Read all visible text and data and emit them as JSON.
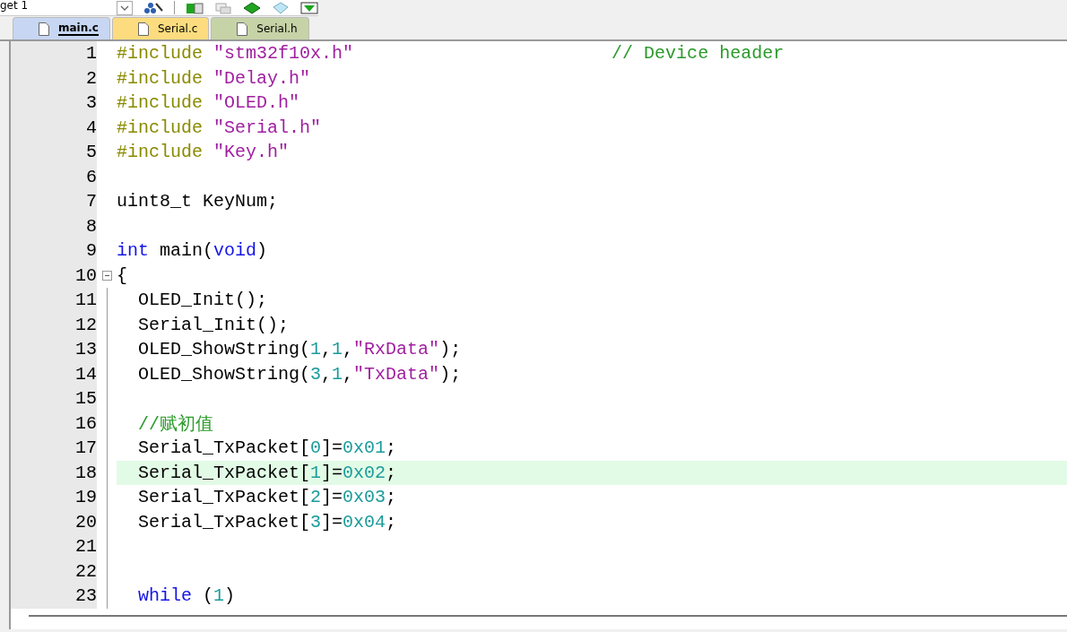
{
  "toolbar": {
    "target_select": "get 1"
  },
  "tabs": [
    {
      "label": "main.c",
      "selected": true,
      "color": "#c7d6f2"
    },
    {
      "label": "Serial.c",
      "selected": false,
      "color": "#fcdc7e"
    },
    {
      "label": "Serial.h",
      "selected": false,
      "color": "#c6d3a6"
    }
  ],
  "editor": {
    "lines": [
      {
        "number": "1",
        "kind": "line",
        "highlighted": false,
        "tokens": [
          {
            "kind": "preproc",
            "text": "#include "
          },
          {
            "kind": "string",
            "text": "\"stm32f10x.h\""
          },
          {
            "kind": "comment",
            "text": "                        // Device header"
          }
        ]
      },
      {
        "number": "2",
        "kind": "line",
        "highlighted": false,
        "tokens": [
          {
            "kind": "preproc",
            "text": "#include "
          },
          {
            "kind": "string",
            "text": "\"Delay.h\""
          }
        ]
      },
      {
        "number": "3",
        "kind": "line",
        "highlighted": false,
        "tokens": [
          {
            "kind": "preproc",
            "text": "#include "
          },
          {
            "kind": "string",
            "text": "\"OLED.h\""
          }
        ]
      },
      {
        "number": "4",
        "kind": "line",
        "highlighted": false,
        "tokens": [
          {
            "kind": "preproc",
            "text": "#include "
          },
          {
            "kind": "string",
            "text": "\"Serial.h\""
          }
        ]
      },
      {
        "number": "5",
        "kind": "line",
        "highlighted": false,
        "tokens": [
          {
            "kind": "preproc",
            "text": "#include "
          },
          {
            "kind": "string",
            "text": "\"Key.h\""
          }
        ]
      },
      {
        "number": "6",
        "kind": "line",
        "highlighted": false
      },
      {
        "number": "7",
        "kind": "line",
        "highlighted": false,
        "tokens": [
          {
            "kind": "plain",
            "text": "uint8_t KeyNum;"
          }
        ]
      },
      {
        "number": "8",
        "kind": "line",
        "highlighted": false
      },
      {
        "number": "9",
        "kind": "line",
        "highlighted": false,
        "tokens": [
          {
            "kind": "keyword",
            "text": "int"
          },
          {
            "kind": "plain",
            "text": " main("
          },
          {
            "kind": "keyword",
            "text": "void"
          },
          {
            "kind": "plain",
            "text": ")"
          }
        ]
      },
      {
        "number": "10",
        "kind": "fold-start",
        "highlighted": false,
        "tokens": [
          {
            "kind": "plain",
            "text": "{"
          }
        ]
      },
      {
        "number": "11",
        "kind": "fold-body",
        "highlighted": false,
        "tokens": [
          {
            "kind": "plain",
            "text": "  OLED_Init();"
          }
        ]
      },
      {
        "number": "12",
        "kind": "fold-body",
        "highlighted": false,
        "tokens": [
          {
            "kind": "plain",
            "text": "  Serial_Init();"
          }
        ]
      },
      {
        "number": "13",
        "kind": "fold-body",
        "highlighted": false,
        "tokens": [
          {
            "kind": "plain",
            "text": "  OLED_ShowString("
          },
          {
            "kind": "number",
            "text": "1"
          },
          {
            "kind": "plain",
            "text": ","
          },
          {
            "kind": "number",
            "text": "1"
          },
          {
            "kind": "plain",
            "text": ","
          },
          {
            "kind": "string",
            "text": "\"RxData\""
          },
          {
            "kind": "plain",
            "text": ");"
          }
        ]
      },
      {
        "number": "14",
        "kind": "fold-body",
        "highlighted": false,
        "tokens": [
          {
            "kind": "plain",
            "text": "  OLED_ShowString("
          },
          {
            "kind": "number",
            "text": "3"
          },
          {
            "kind": "plain",
            "text": ","
          },
          {
            "kind": "number",
            "text": "1"
          },
          {
            "kind": "plain",
            "text": ","
          },
          {
            "kind": "string",
            "text": "\"TxData\""
          },
          {
            "kind": "plain",
            "text": ");"
          }
        ]
      },
      {
        "number": "15",
        "kind": "fold-body",
        "highlighted": false
      },
      {
        "number": "16",
        "kind": "fold-body",
        "highlighted": false,
        "tokens": [
          {
            "kind": "comment",
            "text": "  //赋初值"
          }
        ]
      },
      {
        "number": "17",
        "kind": "fold-body",
        "highlighted": false,
        "tokens": [
          {
            "kind": "plain",
            "text": "  Serial_TxPacket["
          },
          {
            "kind": "number",
            "text": "0"
          },
          {
            "kind": "plain",
            "text": "]="
          },
          {
            "kind": "number",
            "text": "0x01"
          },
          {
            "kind": "plain",
            "text": ";"
          }
        ]
      },
      {
        "number": "18",
        "kind": "fold-body",
        "highlighted": true,
        "tokens": [
          {
            "kind": "plain",
            "text": "  Serial_TxPacket["
          },
          {
            "kind": "number",
            "text": "1"
          },
          {
            "kind": "plain",
            "text": "]="
          },
          {
            "kind": "number",
            "text": "0x02"
          },
          {
            "kind": "plain",
            "text": ";"
          }
        ]
      },
      {
        "number": "19",
        "kind": "fold-body",
        "highlighted": false,
        "tokens": [
          {
            "kind": "plain",
            "text": "  Serial_TxPacket["
          },
          {
            "kind": "number",
            "text": "2"
          },
          {
            "kind": "plain",
            "text": "]="
          },
          {
            "kind": "number",
            "text": "0x03"
          },
          {
            "kind": "plain",
            "text": ";"
          }
        ]
      },
      {
        "number": "20",
        "kind": "fold-body",
        "highlighted": false,
        "tokens": [
          {
            "kind": "plain",
            "text": "  Serial_TxPacket["
          },
          {
            "kind": "number",
            "text": "3"
          },
          {
            "kind": "plain",
            "text": "]="
          },
          {
            "kind": "number",
            "text": "0x04"
          },
          {
            "kind": "plain",
            "text": ";"
          }
        ]
      },
      {
        "number": "21",
        "kind": "fold-body",
        "highlighted": false
      },
      {
        "number": "22",
        "kind": "fold-body",
        "highlighted": false
      },
      {
        "number": "23",
        "kind": "fold-body",
        "highlighted": false,
        "tokens": [
          {
            "kind": "keyword",
            "text": "  while"
          },
          {
            "kind": "plain",
            "text": " ("
          },
          {
            "kind": "number",
            "text": "1"
          },
          {
            "kind": "plain",
            "text": ")"
          }
        ]
      }
    ]
  }
}
